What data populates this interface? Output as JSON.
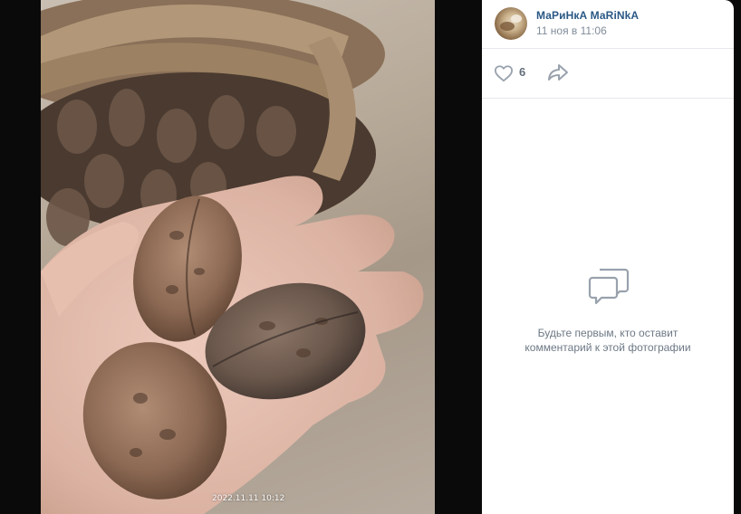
{
  "photo": {
    "timestamp": "2022.11.11 10:12"
  },
  "post": {
    "author_name": "МаРиНкА МаRiNkA",
    "date": "11 ноя в 11:06",
    "likes_count": "6",
    "icons": {
      "like": "heart-icon",
      "share": "share-arrow-icon",
      "comments": "comment-bubbles-icon"
    }
  },
  "comments": {
    "empty_line1": "Будьте первым, кто оставит",
    "empty_line2": "комментарий к этой фотографии"
  },
  "colors": {
    "link": "#2a5885",
    "muted": "#818c99",
    "icon": "#99a2ad",
    "divider": "#e7e8ec"
  }
}
